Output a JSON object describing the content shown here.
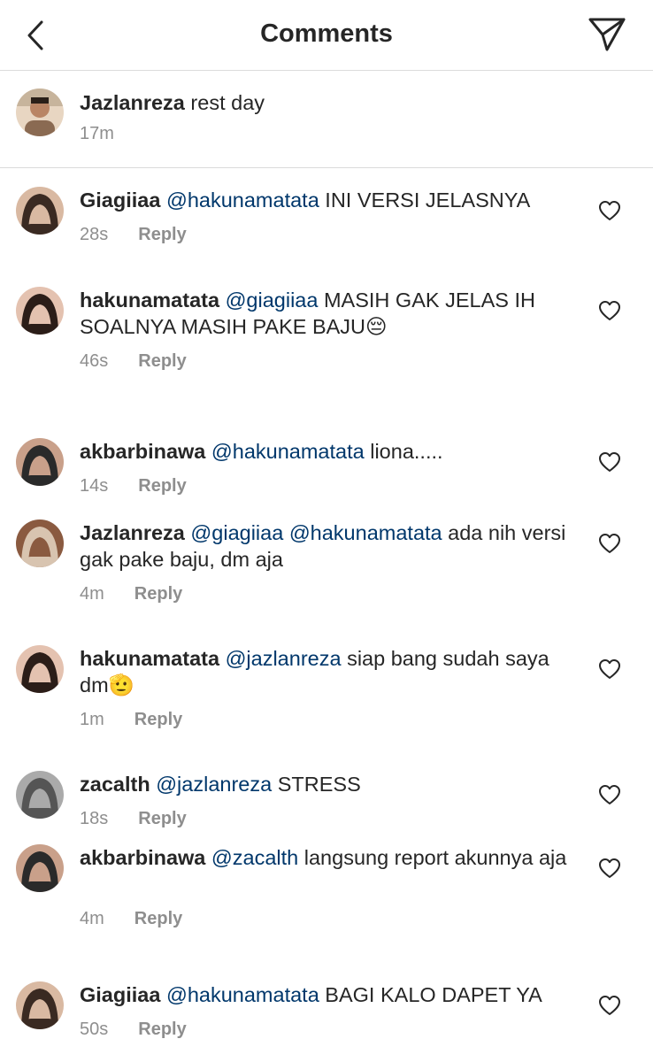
{
  "header": {
    "title": "Comments",
    "back_icon": "chevron-left-icon",
    "send_icon": "paper-plane-icon"
  },
  "caption": {
    "username": "Jazlanreza",
    "text": "rest day",
    "time": "17m"
  },
  "reply_label": "Reply",
  "comments": [
    {
      "username": "Giagiiaa",
      "mention": "@hakunamatata",
      "text": "INI VERSI JELASNYA",
      "time": "28s",
      "avatar_colors": [
        "#3a2a22",
        "#d9b9a2"
      ]
    },
    {
      "username": "hakunamatata",
      "mention": "@giagiiaa",
      "text": "MASIH GAK JELAS IH SOALNYA MASIH PAKE BAJU😔",
      "time": "46s",
      "avatar_colors": [
        "#2b1d18",
        "#e4c2b0"
      ]
    },
    {
      "username": "akbarbinawa",
      "mention": "@hakunamatata",
      "text": "liona.....",
      "time": "14s",
      "avatar_colors": [
        "#2a2a2a",
        "#c9a08a"
      ]
    },
    {
      "username": "Jazlanreza",
      "mention": "@giagiiaa @hakunamatata",
      "text": "ada nih versi gak pake baju, dm aja",
      "time": "4m",
      "avatar_colors": [
        "#d8c4b0",
        "#8a5a40"
      ]
    },
    {
      "username": "hakunamatata",
      "mention": "@jazlanreza",
      "text": "siap bang sudah saya dm🫡",
      "time": "1m",
      "avatar_colors": [
        "#2b1d18",
        "#e4c2b0"
      ]
    },
    {
      "username": "zacalth",
      "mention": "@jazlanreza",
      "text": "STRESS",
      "time": "18s",
      "avatar_colors": [
        "#555555",
        "#aaaaaa"
      ]
    },
    {
      "username": "akbarbinawa",
      "mention": "@zacalth",
      "text": "langsung report akunnya aja",
      "time": "4m",
      "avatar_colors": [
        "#2a2a2a",
        "#c9a08a"
      ]
    },
    {
      "username": "Giagiiaa",
      "mention": "@hakunamatata",
      "text": "BAGI KALO DAPET YA",
      "time": "50s",
      "avatar_colors": [
        "#3a2a22",
        "#d9b9a2"
      ]
    }
  ],
  "icons": {
    "like": "heart-outline-icon"
  }
}
